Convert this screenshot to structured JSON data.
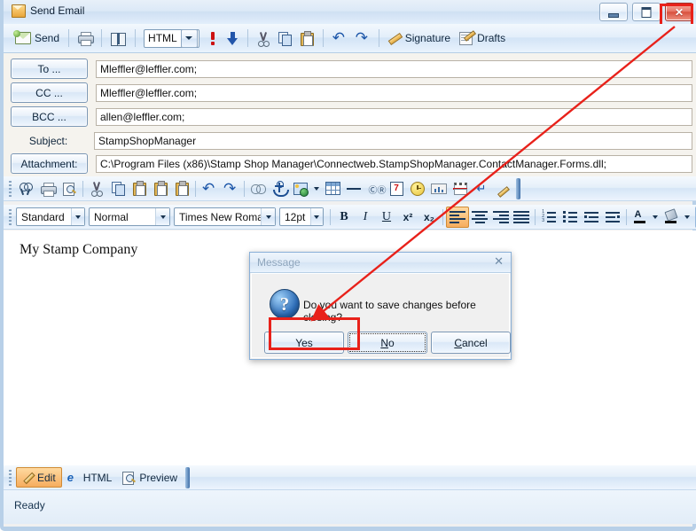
{
  "window": {
    "title": "Send Email",
    "icon": "envelope-document-icon",
    "controls": {
      "minimize": "—",
      "maximize": "□",
      "close": "✕"
    }
  },
  "toolbar": {
    "send_label": "Send",
    "print_icon": "printer-icon",
    "addressbook_icon": "address-book-icon",
    "format_combo": {
      "value": "HTML"
    },
    "priority_icon": "high-priority-icon",
    "low_priority_icon": "low-priority-arrow-icon",
    "cut_icon": "cut-icon",
    "copy_icon": "copy-icon",
    "paste_icon": "paste-icon",
    "undo_icon": "undo-icon",
    "redo_icon": "redo-icon",
    "signature_label": "Signature",
    "drafts_label": "Drafts"
  },
  "fields": {
    "to": {
      "button": "To ...",
      "value": "Mleffler@leffler.com;"
    },
    "cc": {
      "button": "CC ...",
      "value": "Mleffler@leffler.com;"
    },
    "bcc": {
      "button": "BCC ...",
      "value": "allen@leffler.com;"
    },
    "subject": {
      "label": "Subject:",
      "value": "StampShopManager"
    },
    "attachment": {
      "button": "Attachment:",
      "value": "C:\\Program Files (x86)\\Stamp Shop Manager\\Connectweb.StampShopManager.ContactManager.Forms.dll;"
    }
  },
  "editor_toolbar_1": [
    {
      "name": "find-icon"
    },
    {
      "name": "print-icon"
    },
    {
      "name": "print-preview-icon"
    },
    {
      "name": "cut-icon"
    },
    {
      "name": "copy-icon"
    },
    {
      "name": "paste-icon"
    },
    {
      "name": "paste-from-word-icon"
    },
    {
      "name": "paste-as-text-icon"
    },
    {
      "name": "undo-icon"
    },
    {
      "name": "redo-icon"
    },
    {
      "name": "hyperlink-icon"
    },
    {
      "name": "anchor-icon"
    },
    {
      "name": "insert-image-icon"
    },
    {
      "name": "insert-table-icon"
    },
    {
      "name": "horizontal-rule-icon"
    },
    {
      "name": "special-character-icon"
    },
    {
      "name": "insert-date-icon"
    },
    {
      "name": "insert-time-icon"
    },
    {
      "name": "insert-chart-icon"
    },
    {
      "name": "page-break-icon"
    },
    {
      "name": "line-break-icon"
    },
    {
      "name": "format-painter-icon"
    }
  ],
  "editor_toolbar_2": {
    "style_select": {
      "value": "Standard"
    },
    "paragraph_select": {
      "value": "Normal"
    },
    "font_select": {
      "value": "Times New Roman"
    },
    "size_select": {
      "value": "12pt"
    },
    "bold": "B",
    "italic": "I",
    "underline": "U",
    "superscript": "x²",
    "subscript": "x₂",
    "align_left": "align-left-icon",
    "align_center": "align-center-icon",
    "align_right": "align-right-icon",
    "align_justify": "align-justify-icon",
    "numbered_list": "numbered-list-icon",
    "bullet_list": "bullet-list-icon",
    "indent": "increase-indent-icon",
    "outdent": "decrease-indent-icon",
    "font_color": "font-color-icon",
    "highlight_color": "highlight-color-icon"
  },
  "body": {
    "text": "My Stamp Company"
  },
  "tabs": [
    {
      "label": "Edit",
      "icon": "edit-pencil-icon",
      "active": true
    },
    {
      "label": "HTML",
      "icon": "internet-explorer-icon",
      "active": false
    },
    {
      "label": "Preview",
      "icon": "preview-magnifier-icon",
      "active": false
    }
  ],
  "statusbar": {
    "text": "Ready"
  },
  "dialog": {
    "title": "Message",
    "close": "✕",
    "icon": "question-mark-icon",
    "icon_glyph": "?",
    "message": "Do you want to save changes before closing?",
    "buttons": [
      {
        "label": "Yes",
        "mnemonic": "Y",
        "rest": "es",
        "highlighted": true
      },
      {
        "label": "No",
        "mnemonic": "N",
        "rest": "o",
        "focused": true
      },
      {
        "label": "Cancel",
        "mnemonic": "C",
        "rest": "ancel"
      }
    ]
  },
  "annotation": {
    "color": "#e8211a",
    "arrow_from": "close-button",
    "arrow_to": "yes-button"
  }
}
